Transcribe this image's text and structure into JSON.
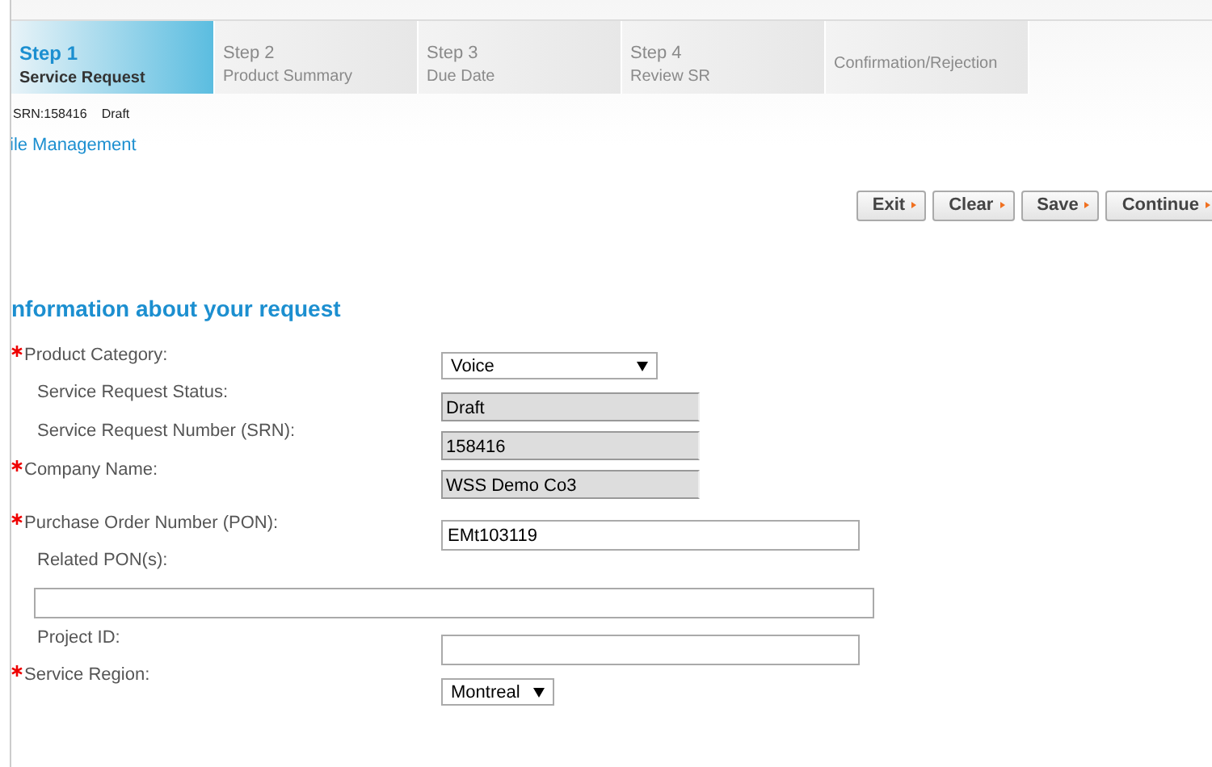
{
  "steps": [
    {
      "number": "Step 1",
      "label": "Service Request",
      "selected": true
    },
    {
      "number": "Step 2",
      "label": "Product Summary",
      "selected": false
    },
    {
      "number": "Step 3",
      "label": "Due Date",
      "selected": false
    },
    {
      "number": "Step 4",
      "label": "Review SR",
      "selected": false
    },
    {
      "label": "Confirmation/Rejection",
      "selected": false
    }
  ],
  "status_line": {
    "srn": "SRN:158416",
    "status": "Draft"
  },
  "file_link": "ile Management",
  "buttons": [
    "Exit",
    "Clear",
    "Save",
    "Continue"
  ],
  "section_title": "nformation about your request",
  "fields": [
    {
      "label": "Product Category:",
      "required": true,
      "kind": "select",
      "value": "Voice"
    },
    {
      "label": "Service Request Status:",
      "required": false,
      "kind": "readonly",
      "value": "Draft"
    },
    {
      "label": "Service Request Number (SRN):",
      "required": false,
      "kind": "readonly",
      "value": "158416"
    },
    {
      "label": "Company Name:",
      "required": true,
      "kind": "readonly",
      "value": "WSS Demo Co3"
    },
    {
      "label": "Purchase Order Number (PON):",
      "required": true,
      "kind": "text",
      "value": "EMt103119"
    },
    {
      "label": "Related PON(s):",
      "required": false,
      "kind": "wide"
    },
    {
      "label": "Project ID:",
      "required": false,
      "kind": "text"
    },
    {
      "label": "Service Region:",
      "required": true,
      "kind": "small-select",
      "value": "Montreal"
    }
  ]
}
